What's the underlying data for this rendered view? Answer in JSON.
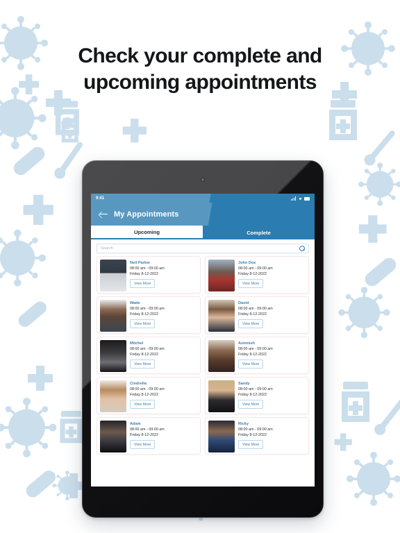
{
  "headline": {
    "line1": "Check your complete and",
    "line2": "upcoming appointments"
  },
  "colors": {
    "header_light_blue": "#5898c0",
    "header_dark_blue": "#2b7cb0",
    "accent_blue": "#3b7fae",
    "background": "#ffffff",
    "pattern_blue": "#b9d3e6",
    "text_dark": "#15161a"
  },
  "device": {
    "status_bar": {
      "time": "9:41",
      "icons": [
        "signal-icon",
        "wifi-icon",
        "battery-icon"
      ]
    },
    "appbar": {
      "back_icon": "back-arrow-icon",
      "title": "My Appointments"
    }
  },
  "app": {
    "tabs": [
      {
        "label": "Upcoming",
        "active": false
      },
      {
        "label": "Complete",
        "active": true
      }
    ],
    "search": {
      "placeholder": "Search",
      "value": "",
      "icon": "search-icon"
    },
    "view_more_label": "View More",
    "appointments": [
      {
        "name": "Neil Parker",
        "time": "08:00 am - 09:00 am",
        "date": "Friday 8-12-2022",
        "avatar": "man-white-shirt-bw"
      },
      {
        "name": "John Doe",
        "time": "08:00 am - 09:00 am",
        "date": "Friday 8-12-2022",
        "avatar": "woman-sunglasses-plaid"
      },
      {
        "name": "Wade",
        "time": "08:00 am - 09:00 am",
        "date": "Friday 8-12-2022",
        "avatar": "man-glasses-smiling"
      },
      {
        "name": "David",
        "time": "08:00 am - 09:00 am",
        "date": "Friday 8-12-2022",
        "avatar": "young-man-suit"
      },
      {
        "name": "Mitchel",
        "time": "08:00 am - 09:00 am",
        "date": "Friday 8-12-2022",
        "avatar": "man-curly-hair-bw"
      },
      {
        "name": "Astonish",
        "time": "08:00 am - 09:00 am",
        "date": "Friday 8-12-2022",
        "avatar": "woman-long-hair"
      },
      {
        "name": "Cindrella",
        "time": "08:00 am - 09:00 am",
        "date": "Friday 8-12-2022",
        "avatar": "woman-wavy-hair"
      },
      {
        "name": "Sandy",
        "time": "08:00 am - 09:00 am",
        "date": "Friday 8-12-2022",
        "avatar": "man-black-suit-tie"
      },
      {
        "name": "Adam",
        "time": "08:00 am - 09:00 am",
        "date": "Friday 8-12-2022",
        "avatar": "man-dark-jacket"
      },
      {
        "name": "Ricky",
        "time": "08:00 am - 09:00 am",
        "date": "Friday 8-12-2022",
        "avatar": "man-blue-suit-night"
      }
    ]
  },
  "background_pattern": {
    "motifs": [
      "virus-icon",
      "plus-icon",
      "pill-capsule-icon",
      "medicine-bottle-icon",
      "thermometer-icon",
      "bandage-icon"
    ]
  }
}
